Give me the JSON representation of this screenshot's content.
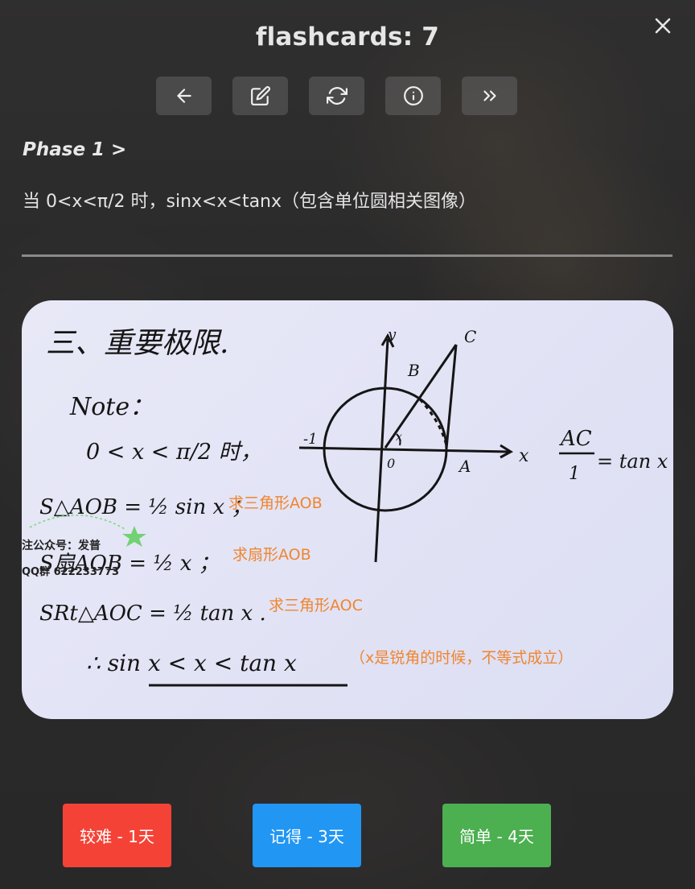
{
  "title": "flashcards: 7",
  "toolbar": {
    "icons": [
      "arrow-left-icon",
      "edit-icon",
      "refresh-icon",
      "info-icon",
      "chevrons-right-icon"
    ]
  },
  "phase": "Phase 1 >",
  "question": "当 0<x<π/2 时，sinx<x<tanx（包含单位圆相关图像）",
  "answer_image": {
    "heading": "三、重要极限.",
    "note_label": "Note：",
    "condition": "0 < x < π/2 时，",
    "eq1": "S△AOB = ½ sin x ；",
    "eq2": "S扇AOB = ½ x ；",
    "eq3": "SRt△AOC = ½ tan x .",
    "conclusion": "∴  sin x < x < tan x",
    "ratio_num": "AC",
    "ratio_den": "1",
    "ratio_rhs": "= tan x",
    "annotations": {
      "a1": "求三角形AOB",
      "a2": "求扇形AOB",
      "a3": "求三角形AOC",
      "a4": "（x是锐角的时候，不等式成立）"
    },
    "watermark_line1": "注公众号：发普",
    "watermark_line2": "QQ群 622233773",
    "diagram_labels": {
      "y": "y",
      "x": "x",
      "c": "C",
      "b": "B",
      "a": "A",
      "o": "0",
      "neg1": "-1",
      "angle": "x"
    }
  },
  "buttons": {
    "hard": "较难 - 1天",
    "good": "记得 - 3天",
    "easy": "简单 - 4天"
  },
  "colors": {
    "hard": "#f44336",
    "good": "#2196f3",
    "easy": "#4caf50",
    "annotation": "#f0852f"
  }
}
